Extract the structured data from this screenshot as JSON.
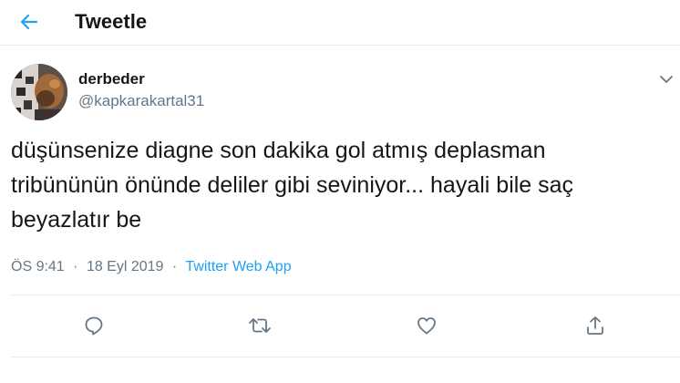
{
  "header": {
    "title": "Tweetle",
    "back_icon": "arrow-left-icon"
  },
  "tweet": {
    "display_name": "derbeder",
    "handle": "@kapkarakartal31",
    "text_lines": [
      "düşünsenize diagne son dakika gol atmış deplasman",
      "tribününün önünde deliler gibi seviniyor... hayali bile saç",
      "beyazlatır be"
    ],
    "time": "ÖS 9:41",
    "date": "18 Eyl 2019",
    "separator": "·",
    "source": "Twitter Web App"
  },
  "actions": [
    {
      "name": "reply",
      "icon": "reply-icon"
    },
    {
      "name": "retweet",
      "icon": "retweet-icon"
    },
    {
      "name": "like",
      "icon": "heart-icon"
    },
    {
      "name": "share",
      "icon": "share-icon"
    }
  ],
  "colors": {
    "accent": "#1da1f2",
    "text": "#14171a",
    "secondary": "#657786",
    "divider": "#e6ecf0"
  }
}
